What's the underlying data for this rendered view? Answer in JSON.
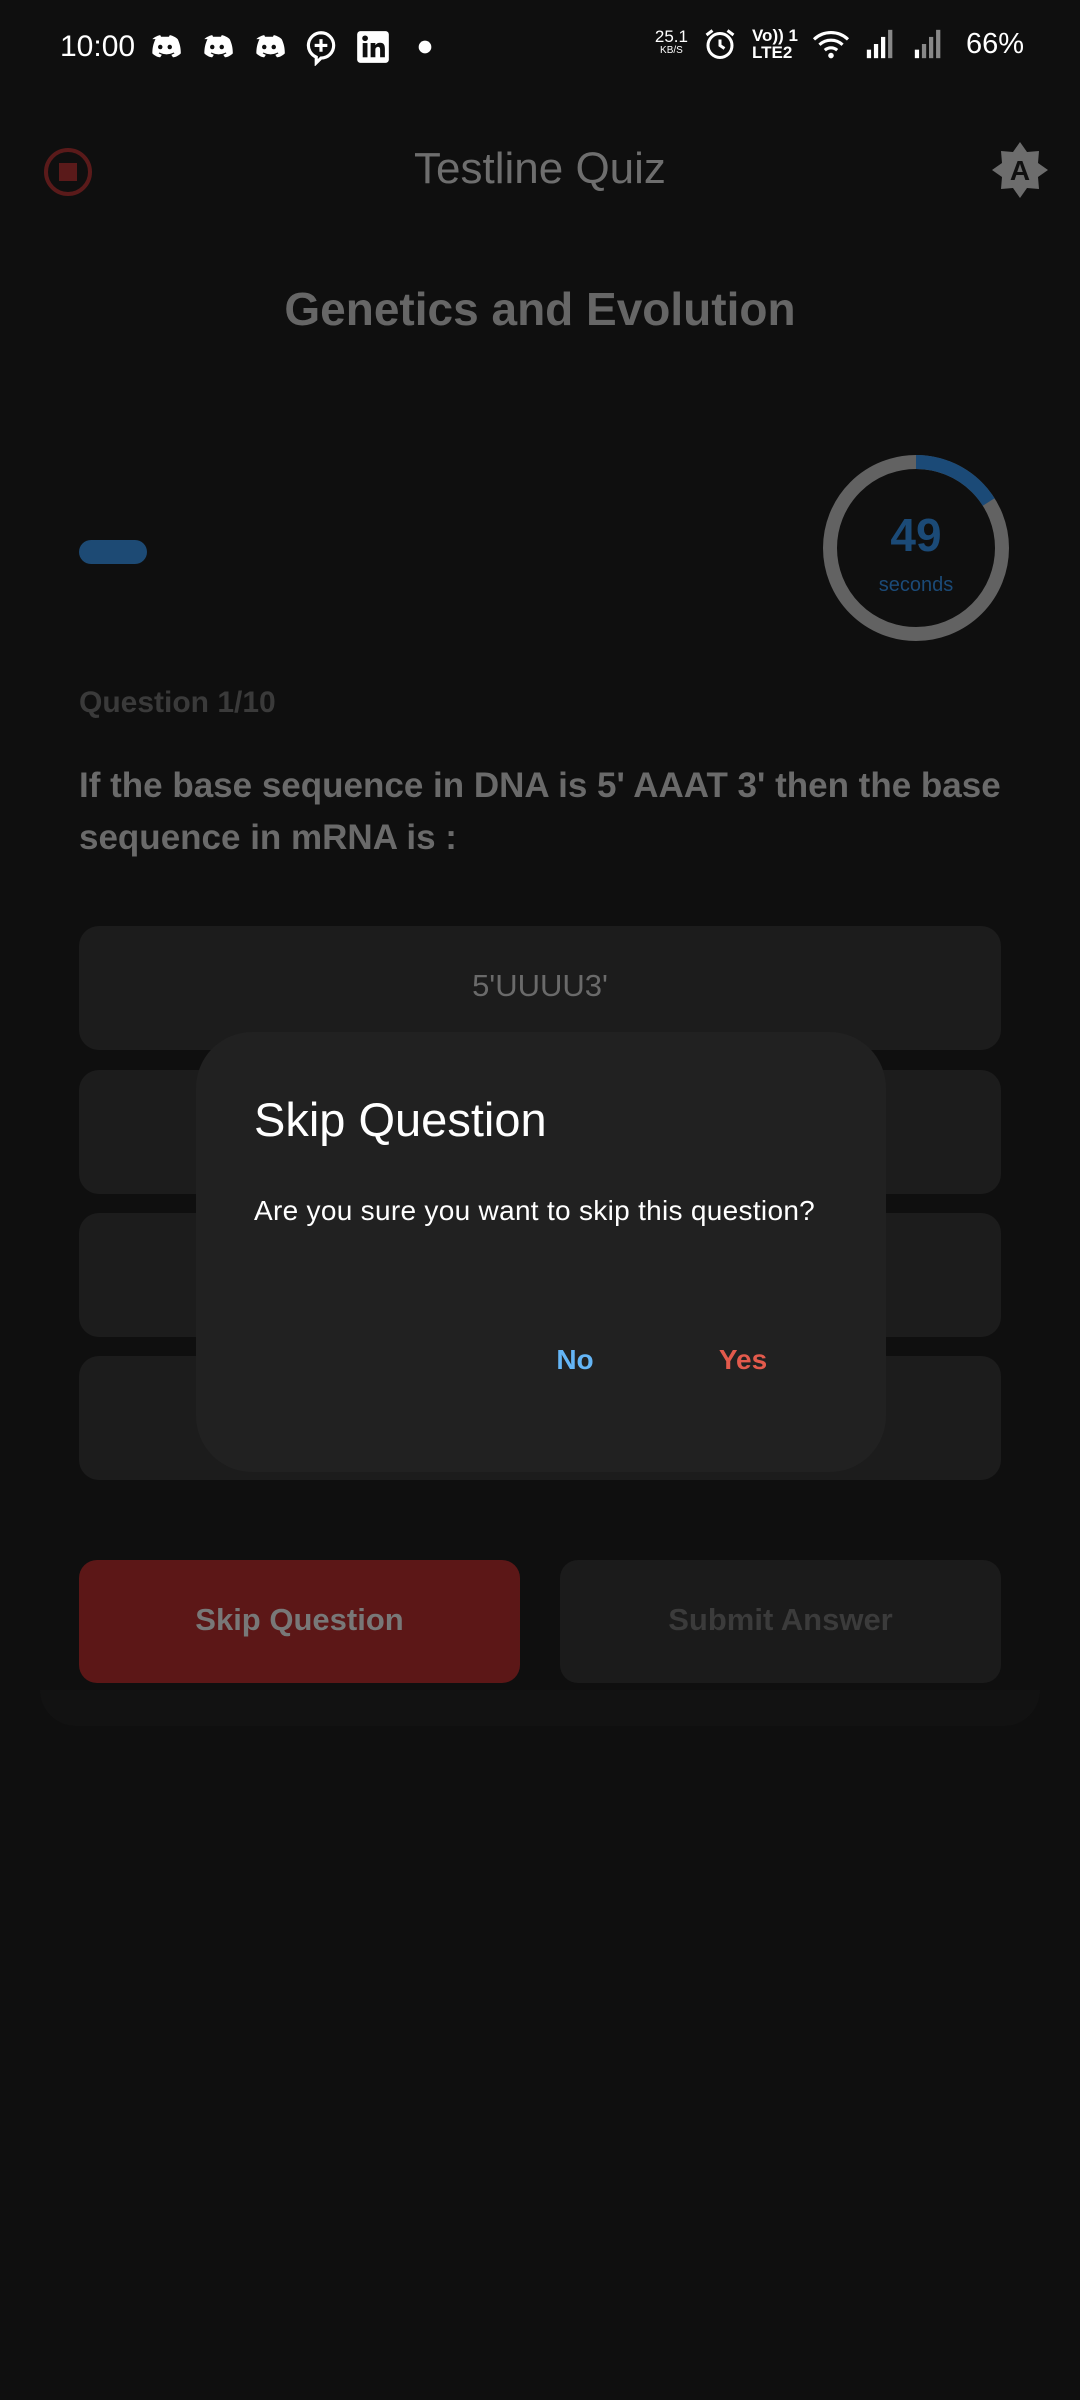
{
  "status_bar": {
    "time": "10:00",
    "net_speed": "25.1",
    "net_speed_unit": "KB/S",
    "lte_line1": "Vo)) 1",
    "lte_line2": "LTE2",
    "battery": "66%",
    "notification_icons": [
      "discord-icon",
      "discord-icon",
      "discord-icon",
      "chat-plus-icon",
      "linkedin-icon",
      "dot-icon"
    ]
  },
  "header": {
    "title": "Testline Quiz",
    "theme_letter": "A"
  },
  "quiz": {
    "topic": "Genetics and Evolution",
    "timer_value": "49",
    "timer_unit": "seconds",
    "timer_fraction_remaining": 0.16,
    "progress_fraction": 0.1,
    "counter": "Question 1/10",
    "question": "If the base sequence in DNA is 5' AAAT 3' then the base sequence in mRNA is :",
    "options": [
      "5'UUUU3'",
      "",
      "",
      ""
    ],
    "skip_label": "Skip Question",
    "submit_label": "Submit Answer"
  },
  "dialog": {
    "title": "Skip Question",
    "message": "Are you sure you want to skip this question?",
    "no_label": "No",
    "yes_label": "Yes"
  },
  "colors": {
    "background": "#0f0f0f",
    "accent_blue": "#64b5f6",
    "danger_red": "#e35a4c",
    "skip_button": "#5c1717"
  }
}
